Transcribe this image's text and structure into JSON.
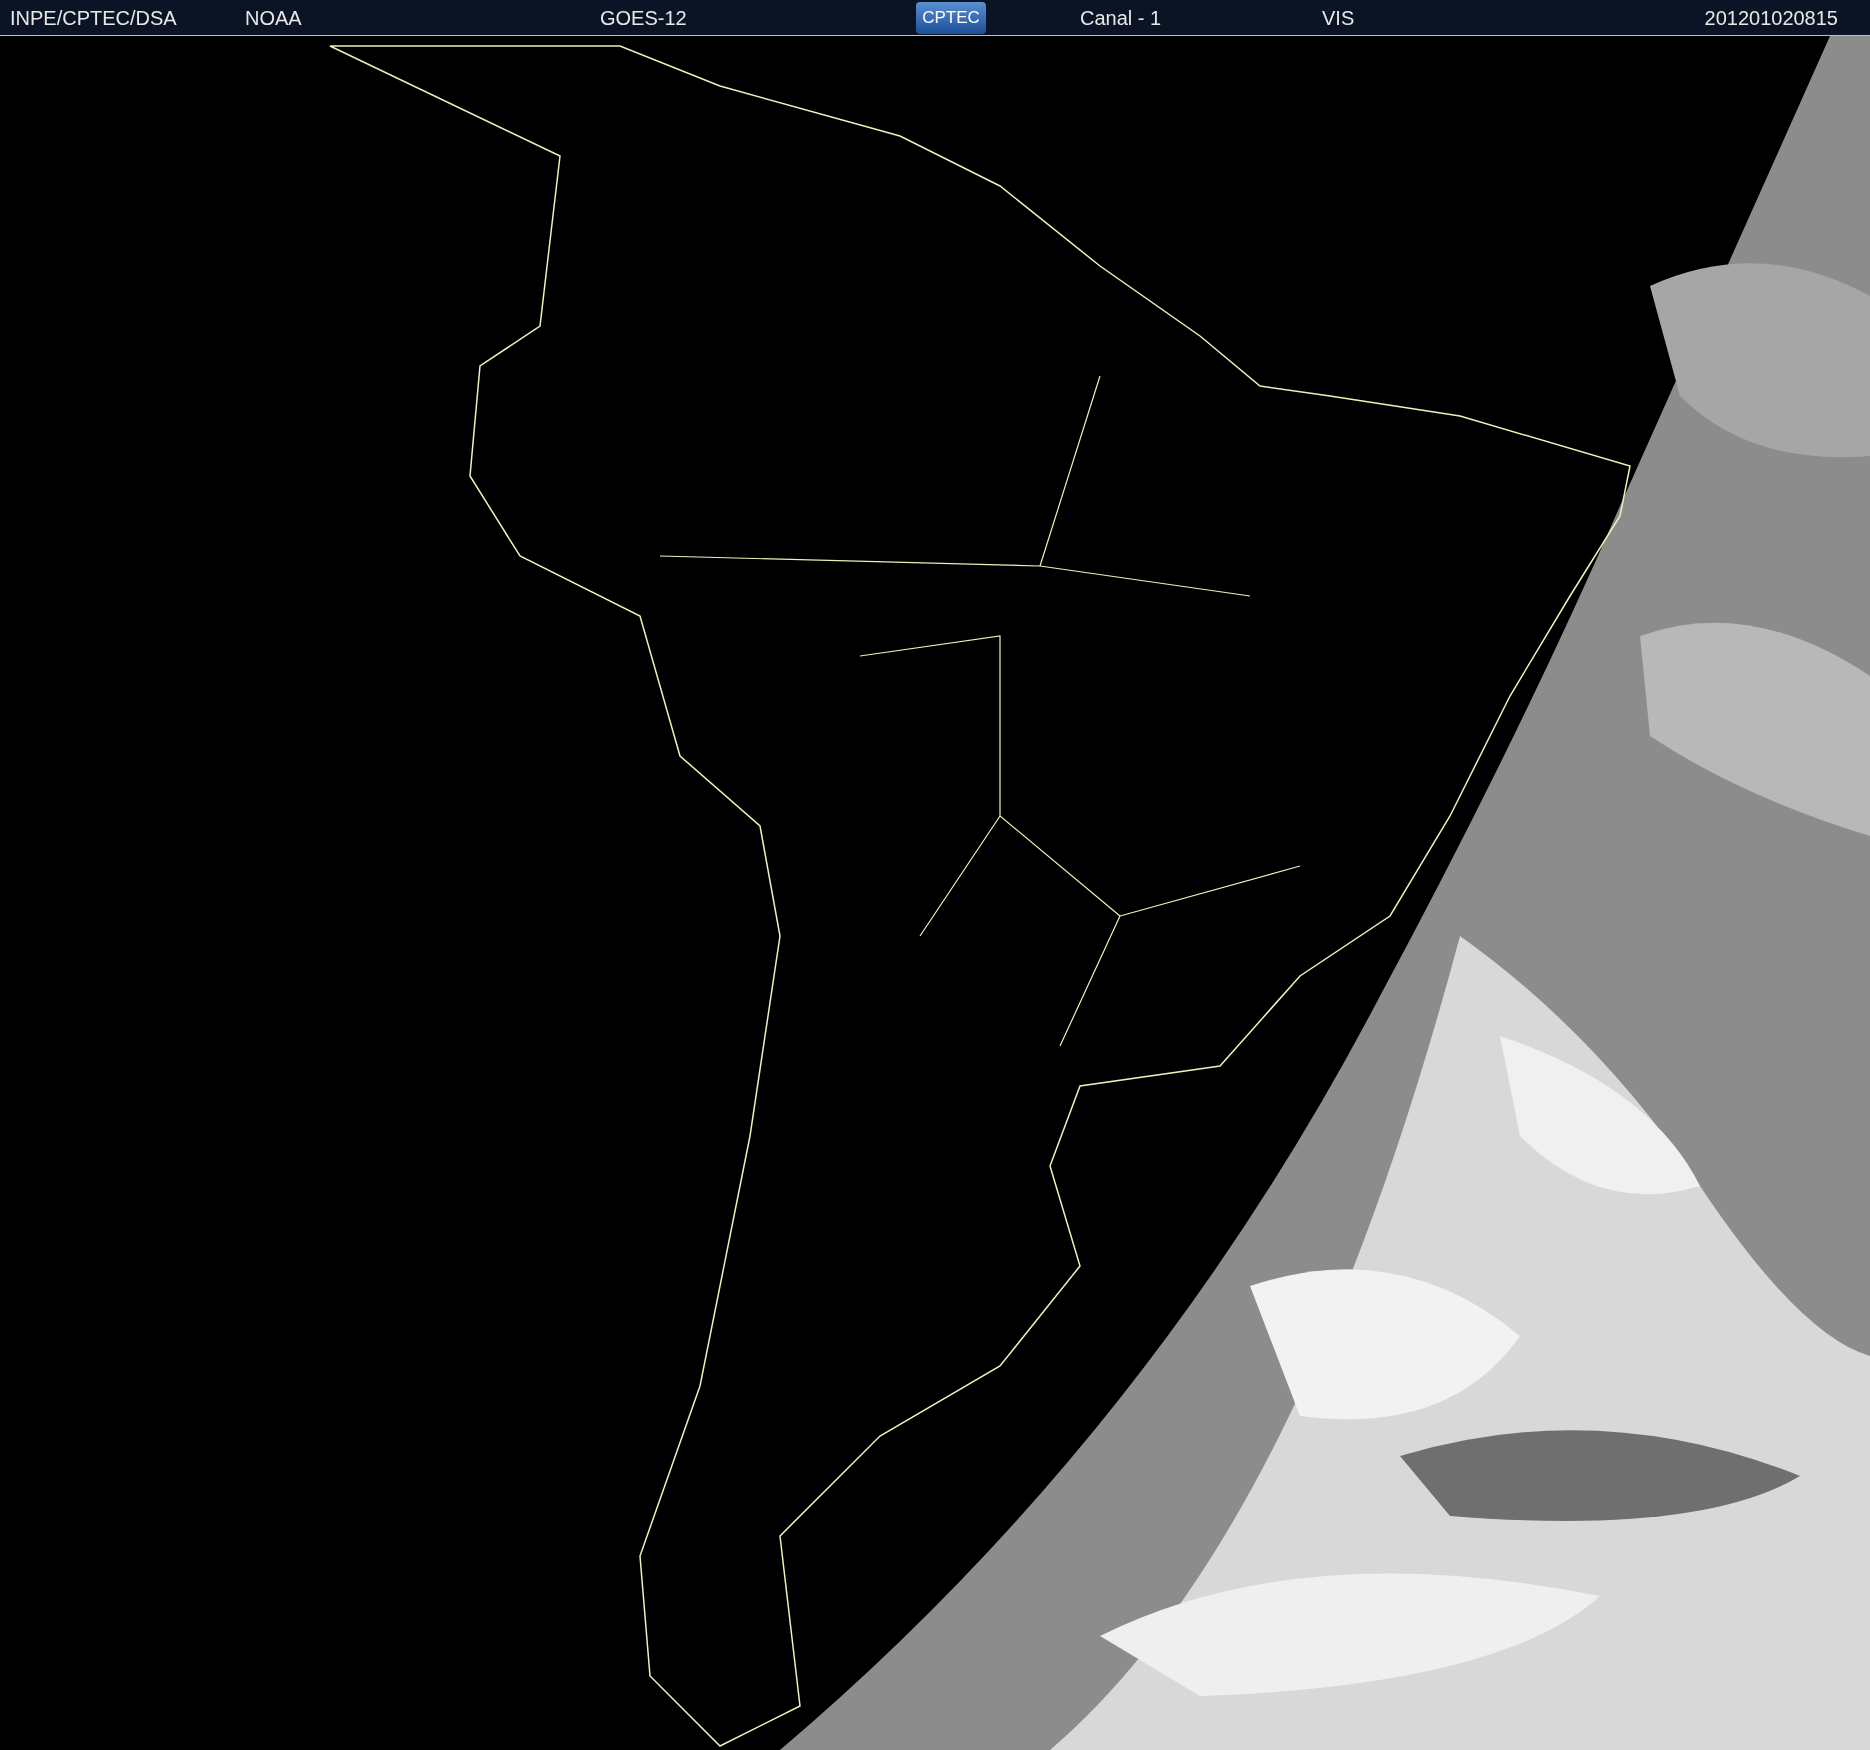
{
  "header": {
    "agency": "INPE/CPTEC/DSA",
    "source": "NOAA",
    "satellite": "GOES-12",
    "logo": "CPTEC",
    "channel": "Canal - 1",
    "band": "VIS",
    "timestamp": "201201020815"
  }
}
